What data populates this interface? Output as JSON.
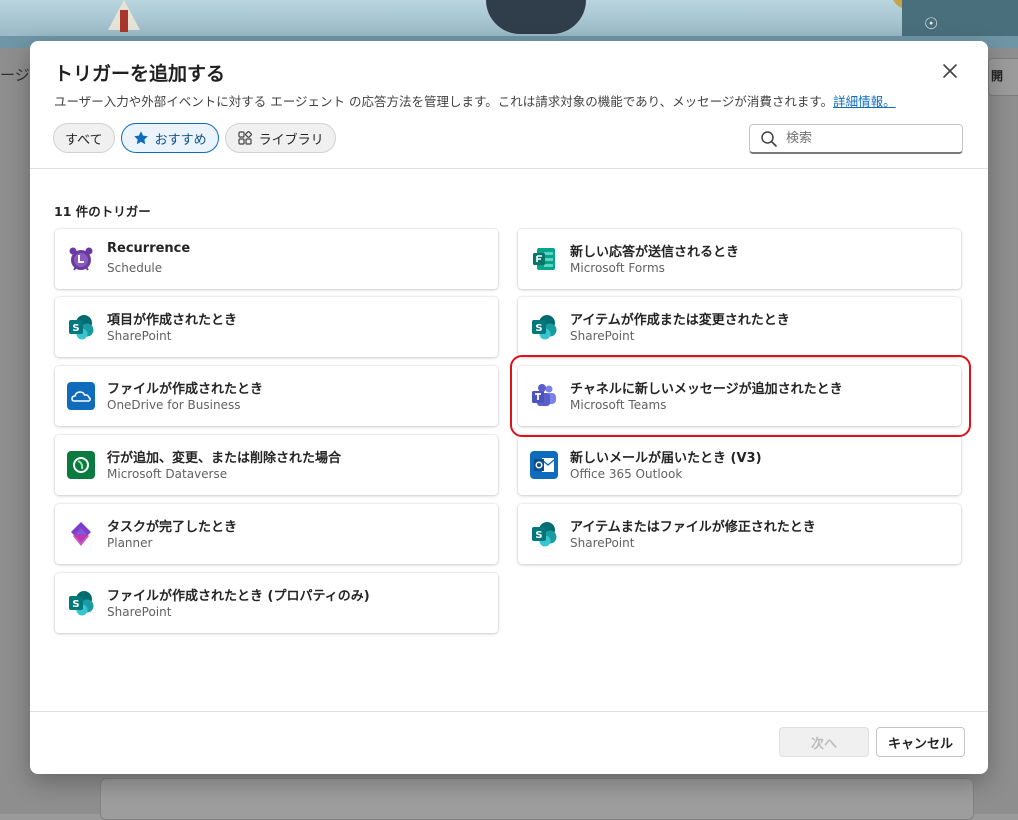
{
  "background": {
    "left_tab_text": "ージ",
    "right_tab_text": "開"
  },
  "dialog": {
    "title": "トリガーを追加する",
    "description": "ユーザー入力や外部イベントに対する エージェント の応答方法を管理します。これは請求対象の機能であり、メッセージが消費されます。",
    "learn_more": "詳細情報。",
    "close_icon": "close-icon",
    "filters": [
      {
        "label": "すべて",
        "icon": "",
        "active": false
      },
      {
        "label": "おすすめ",
        "icon": "star-icon",
        "active": true
      },
      {
        "label": "ライブラリ",
        "icon": "library-icon",
        "active": false
      }
    ],
    "search": {
      "placeholder": "検索",
      "value": ""
    },
    "count_label": "11 件のトリガー",
    "triggers": [
      {
        "title": "Recurrence",
        "subtitle": "Schedule",
        "icon": "alarm-clock-icon",
        "color": "#6b3a9e"
      },
      {
        "title": "新しい応答が送信されるとき",
        "subtitle": "Microsoft Forms",
        "icon": "forms-icon",
        "color": "#077568"
      },
      {
        "title": "項目が作成されたとき",
        "subtitle": "SharePoint",
        "icon": "sharepoint-icon",
        "color": "#036c70"
      },
      {
        "title": "アイテムが作成または変更されたとき",
        "subtitle": "SharePoint",
        "icon": "sharepoint-icon",
        "color": "#036c70"
      },
      {
        "title": "ファイルが作成されたとき",
        "subtitle": "OneDrive for Business",
        "icon": "onedrive-icon",
        "color": "#0f6cbd"
      },
      {
        "title": "チャネルに新しいメッセージが追加されたとき",
        "subtitle": "Microsoft Teams",
        "icon": "teams-icon",
        "color": "#5b5fc7"
      },
      {
        "title": "行が追加、変更、または削除された場合",
        "subtitle": "Microsoft Dataverse",
        "icon": "dataverse-icon",
        "color": "#0b7a3e"
      },
      {
        "title": "新しいメールが届いたとき (V3)",
        "subtitle": "Office 365 Outlook",
        "icon": "outlook-icon",
        "color": "#0f6cbd"
      },
      {
        "title": "タスクが完了したとき",
        "subtitle": "Planner",
        "icon": "planner-icon",
        "color": "#7b3fd0"
      },
      {
        "title": "アイテムまたはファイルが修正されたとき",
        "subtitle": "SharePoint",
        "icon": "sharepoint-icon",
        "color": "#036c70"
      },
      {
        "title": "ファイルが作成されたとき (プロパティのみ)",
        "subtitle": "SharePoint",
        "icon": "sharepoint-icon",
        "color": "#036c70"
      }
    ],
    "highlighted_trigger": "チャネルに新しいメッセージが追加されたとき",
    "buttons": {
      "next": "次へ",
      "cancel": "キャンセル"
    }
  }
}
